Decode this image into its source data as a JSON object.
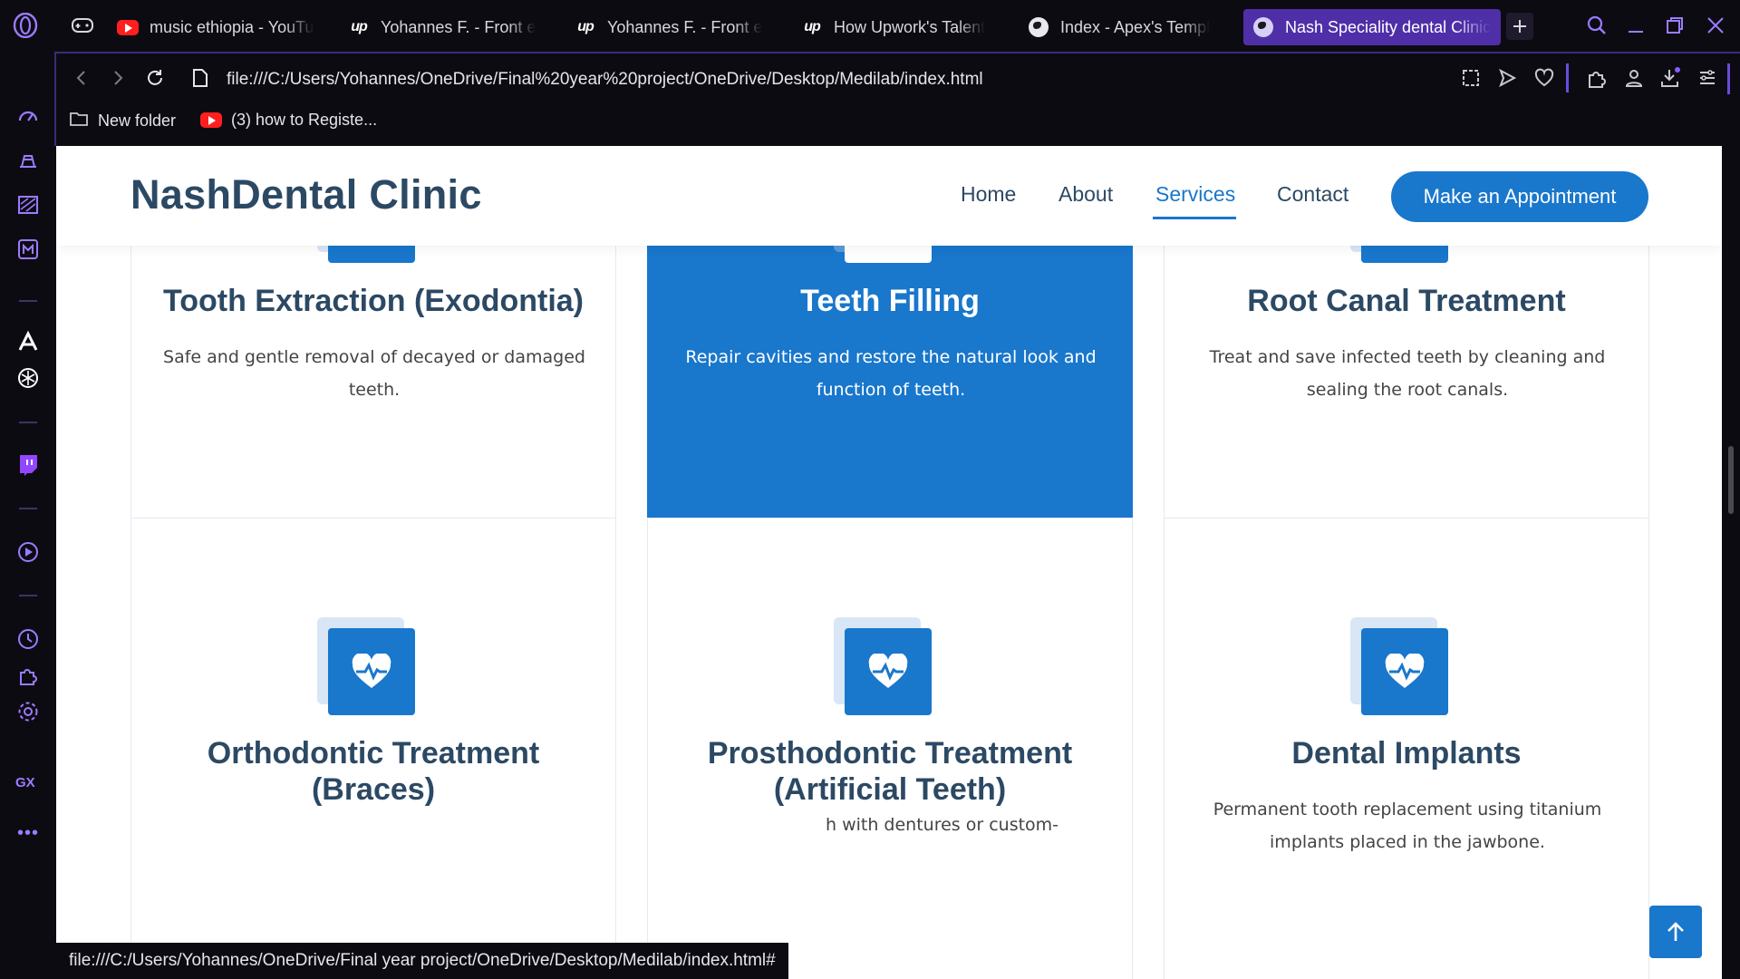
{
  "browser": {
    "tabs": [
      {
        "title": "music ethiopia - YouTube",
        "icon": "youtube-icon"
      },
      {
        "title": "Yohannes F. - Front e",
        "icon": "upwork-icon"
      },
      {
        "title": "Yohannes F. - Front e",
        "icon": "upwork-icon"
      },
      {
        "title": "How Upwork's Talent",
        "icon": "upwork-icon"
      },
      {
        "title": "Index - Apex's Templ",
        "icon": "globe-icon"
      },
      {
        "title": "Nash Speciality dental Clinic",
        "icon": "globe-icon",
        "active": true
      }
    ],
    "url": "file:///C:/Users/Yohannes/OneDrive/Final%20year%20project/OneDrive/Desktop/Medilab/index.html",
    "bookmarks": [
      {
        "label": "New folder",
        "icon": "folder-icon"
      },
      {
        "label": "(3) how to Registe...",
        "icon": "youtube-icon"
      }
    ],
    "status_url": "file:///C:/Users/Yohannes/OneDrive/Final year project/OneDrive/Desktop/Medilab/index.html#",
    "sidebar_badge": "GX",
    "accent": "#4e2fa8"
  },
  "site": {
    "logo": "NashDental Clinic",
    "nav": [
      {
        "label": "Home"
      },
      {
        "label": "About"
      },
      {
        "label": "Services",
        "active": true
      },
      {
        "label": "Contact"
      }
    ],
    "cta": "Make an Appointment",
    "brand_color": "#1977cc",
    "heading_color": "#2c4964"
  },
  "services": [
    {
      "title": "Tooth Extraction (Exodontia)",
      "desc": "Safe and gentle removal of decayed or damaged teeth.",
      "icon": "heartbeat-icon"
    },
    {
      "title": "Teeth Filling",
      "desc": "Repair cavities and restore the natural look and function of teeth.",
      "icon": "heartbeat-icon",
      "highlighted": true
    },
    {
      "title": "Root Canal Treatment",
      "desc": "Treat and save infected teeth by cleaning and sealing the root canals.",
      "icon": "heartbeat-icon"
    },
    {
      "title": "Orthodontic Treatment (Braces)",
      "desc": "",
      "icon": "heartbeat-icon"
    },
    {
      "title": "Prosthodontic Treatment (Artificial Teeth)",
      "desc": "h with dentures or custom-",
      "icon": "heartbeat-icon"
    },
    {
      "title": "Dental Implants",
      "desc": "Permanent tooth replacement using titanium implants placed in the jawbone.",
      "icon": "heartbeat-icon"
    }
  ]
}
